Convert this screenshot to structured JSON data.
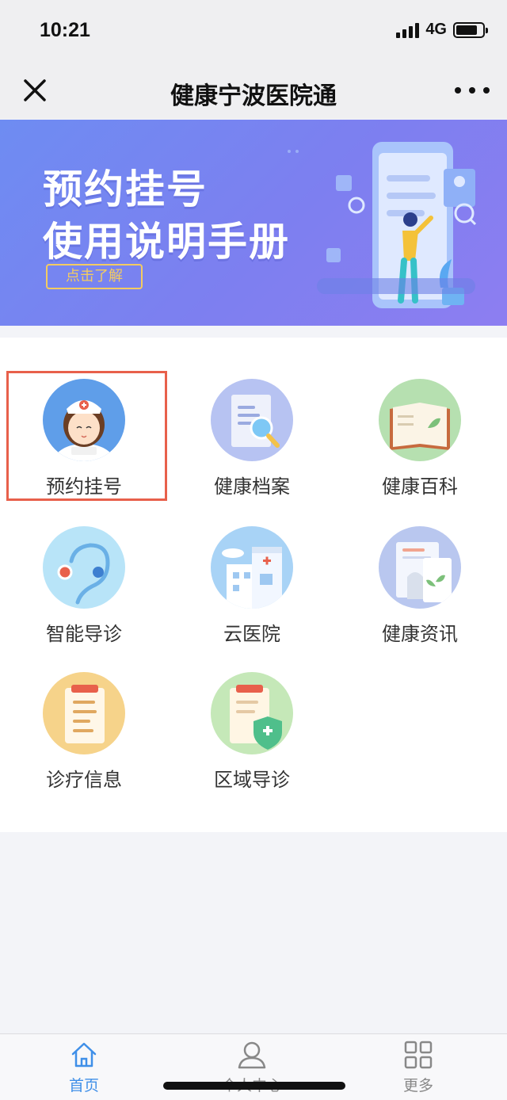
{
  "status_bar": {
    "time": "10:21",
    "network": "4G"
  },
  "nav": {
    "title": "健康宁波医院通"
  },
  "banner": {
    "line1": "预约挂号",
    "line2": "使用说明手册",
    "button": "点击了解"
  },
  "services": [
    {
      "label": "预约挂号",
      "icon": "nurse-icon"
    },
    {
      "label": "健康档案",
      "icon": "records-icon"
    },
    {
      "label": "健康百科",
      "icon": "book-icon"
    },
    {
      "label": "智能导诊",
      "icon": "stethoscope-icon"
    },
    {
      "label": "云医院",
      "icon": "hospital-icon"
    },
    {
      "label": "健康资讯",
      "icon": "news-icon"
    },
    {
      "label": "诊疗信息",
      "icon": "clipboard-icon"
    },
    {
      "label": "区域导诊",
      "icon": "shield-clipboard-icon"
    }
  ],
  "tabs": [
    {
      "label": "首页",
      "icon": "home-icon",
      "active": true
    },
    {
      "label": "个人中心",
      "icon": "user-icon",
      "active": false
    },
    {
      "label": "更多",
      "icon": "grid-icon",
      "active": false
    }
  ],
  "colors": {
    "accent": "#3f8fe8",
    "highlight": "#e8604b",
    "banner": "#7d7ff0"
  }
}
